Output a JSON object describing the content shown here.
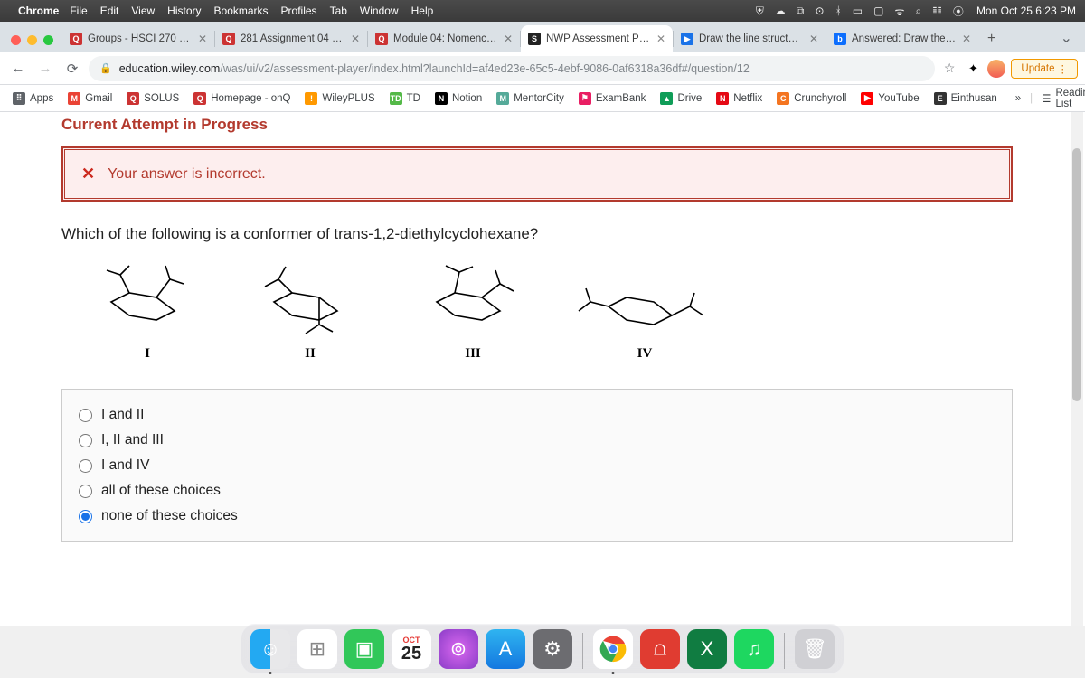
{
  "menubar": {
    "app": "Chrome",
    "items": [
      "File",
      "Edit",
      "View",
      "History",
      "Bookmarks",
      "Profiles",
      "Tab",
      "Window",
      "Help"
    ],
    "clock": "Mon Oct 25  6:23 PM"
  },
  "tabs": [
    {
      "title": "Groups - HSCI 270 - Ble",
      "fav": "fav-red",
      "favtxt": "Q"
    },
    {
      "title": "281 Assignment 04 - Ca",
      "fav": "fav-red",
      "favtxt": "Q"
    },
    {
      "title": "Module 04: Nomenclatu",
      "fav": "fav-red",
      "favtxt": "Q"
    },
    {
      "title": "NWP Assessment Player",
      "fav": "fav-blk",
      "favtxt": "S",
      "active": true
    },
    {
      "title": "Draw the line structure o",
      "fav": "fav-blue",
      "favtxt": "▶"
    },
    {
      "title": "Answered: Draw the two",
      "fav": "fav-b",
      "favtxt": "b"
    }
  ],
  "url": {
    "domain": "education.wiley.com",
    "path": "/was/ui/v2/assessment-player/index.html?launchId=af4ed23e-65c5-4ebf-9086-0af6318a36df#/question/12"
  },
  "update_label": "Update",
  "bookmarks": [
    {
      "label": "Apps",
      "ico": "⠿",
      "bg": "#5f6368"
    },
    {
      "label": "Gmail",
      "ico": "M",
      "bg": "#ea4335"
    },
    {
      "label": "SOLUS",
      "ico": "Q",
      "bg": "#c33"
    },
    {
      "label": "Homepage - onQ",
      "ico": "Q",
      "bg": "#c33"
    },
    {
      "label": "WileyPLUS",
      "ico": "!",
      "bg": "#f90"
    },
    {
      "label": "TD",
      "ico": "TD",
      "bg": "#54b948"
    },
    {
      "label": "Notion",
      "ico": "N",
      "bg": "#000"
    },
    {
      "label": "MentorCity",
      "ico": "M",
      "bg": "#5a9"
    },
    {
      "label": "ExamBank",
      "ico": "⚑",
      "bg": "#e91e63"
    },
    {
      "label": "Drive",
      "ico": "▲",
      "bg": "#0f9d58"
    },
    {
      "label": "Netflix",
      "ico": "N",
      "bg": "#e50914"
    },
    {
      "label": "Crunchyroll",
      "ico": "C",
      "bg": "#f47521"
    },
    {
      "label": "YouTube",
      "ico": "▶",
      "bg": "#f00"
    },
    {
      "label": "Einthusan",
      "ico": "E",
      "bg": "#333"
    }
  ],
  "reading_label": "Reading List",
  "attempt_header": "Current Attempt in Progress",
  "feedback_msg": "Your answer is incorrect.",
  "question": "Which of the following is a conformer of trans-1,2-diethylcyclohexane?",
  "struct_labels": [
    "I",
    "II",
    "III",
    "IV"
  ],
  "options": [
    {
      "label": "I and II",
      "selected": false
    },
    {
      "label": "I, II and III",
      "selected": false
    },
    {
      "label": "I and IV",
      "selected": false
    },
    {
      "label": "all of these choices",
      "selected": false
    },
    {
      "label": "none of these choices",
      "selected": true
    }
  ],
  "calendar": {
    "month": "OCT",
    "day": "25"
  }
}
